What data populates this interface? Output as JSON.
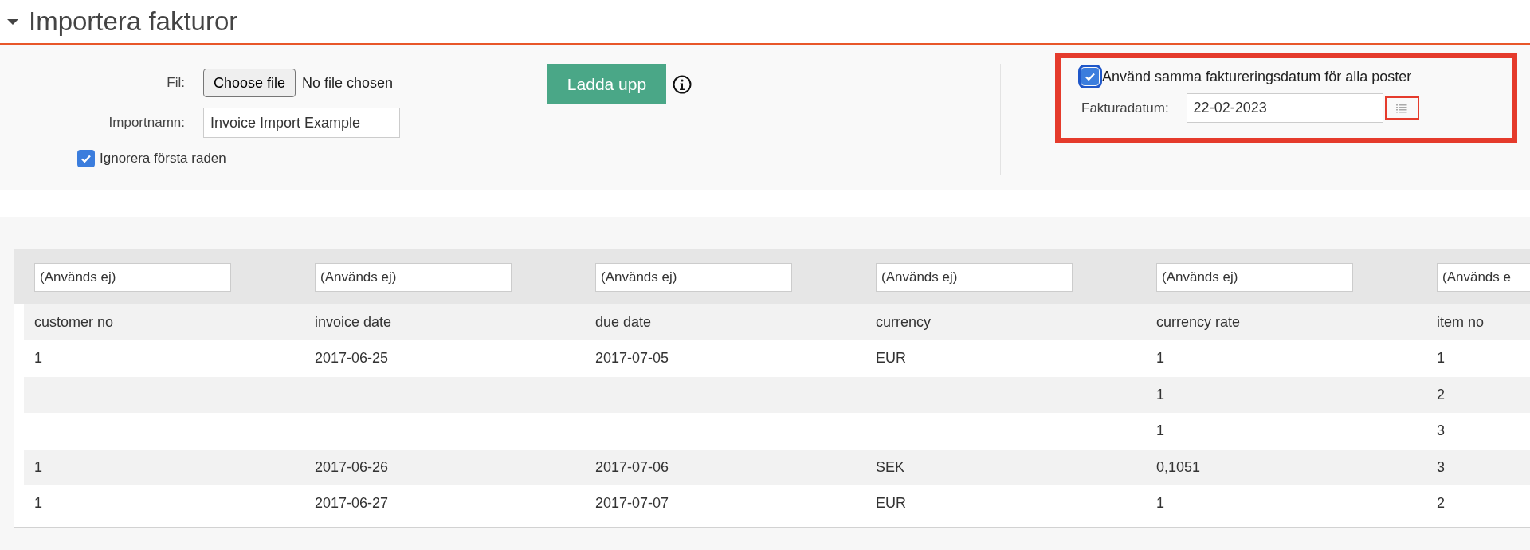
{
  "section": {
    "title": "Importera fakturor",
    "expanded": true
  },
  "form": {
    "file_label": "Fil:",
    "file_button": "Choose file",
    "file_status": "No file chosen",
    "import_name_label": "Importnamn:",
    "import_name_value": "Invoice Import Example",
    "ignore_first_row": {
      "label": "Ignorera första raden",
      "checked": true
    },
    "upload_button": "Ladda upp"
  },
  "date_settings": {
    "same_date": {
      "label": "Använd samma faktureringsdatum för alla poster",
      "checked": true
    },
    "date_label": "Fakturadatum:",
    "date_value": "22-02-2023"
  },
  "table": {
    "mappings": [
      "(Används ej)",
      "(Används ej)",
      "(Används ej)",
      "(Används ej)",
      "(Används ej)",
      "(Används e"
    ],
    "columns": [
      "customer no",
      "invoice date",
      "due date",
      "currency",
      "currency rate",
      "item no"
    ],
    "rows": [
      [
        "1",
        "2017-06-25",
        "2017-07-05",
        "EUR",
        "1",
        "1"
      ],
      [
        null,
        null,
        null,
        null,
        "1",
        "2"
      ],
      [
        null,
        null,
        null,
        null,
        "1",
        "3"
      ],
      [
        "1",
        "2017-06-26",
        "2017-07-06",
        "SEK",
        "0,1051",
        "3"
      ],
      [
        "1",
        "2017-06-27",
        "2017-07-07",
        "EUR",
        "1",
        "2"
      ]
    ]
  }
}
